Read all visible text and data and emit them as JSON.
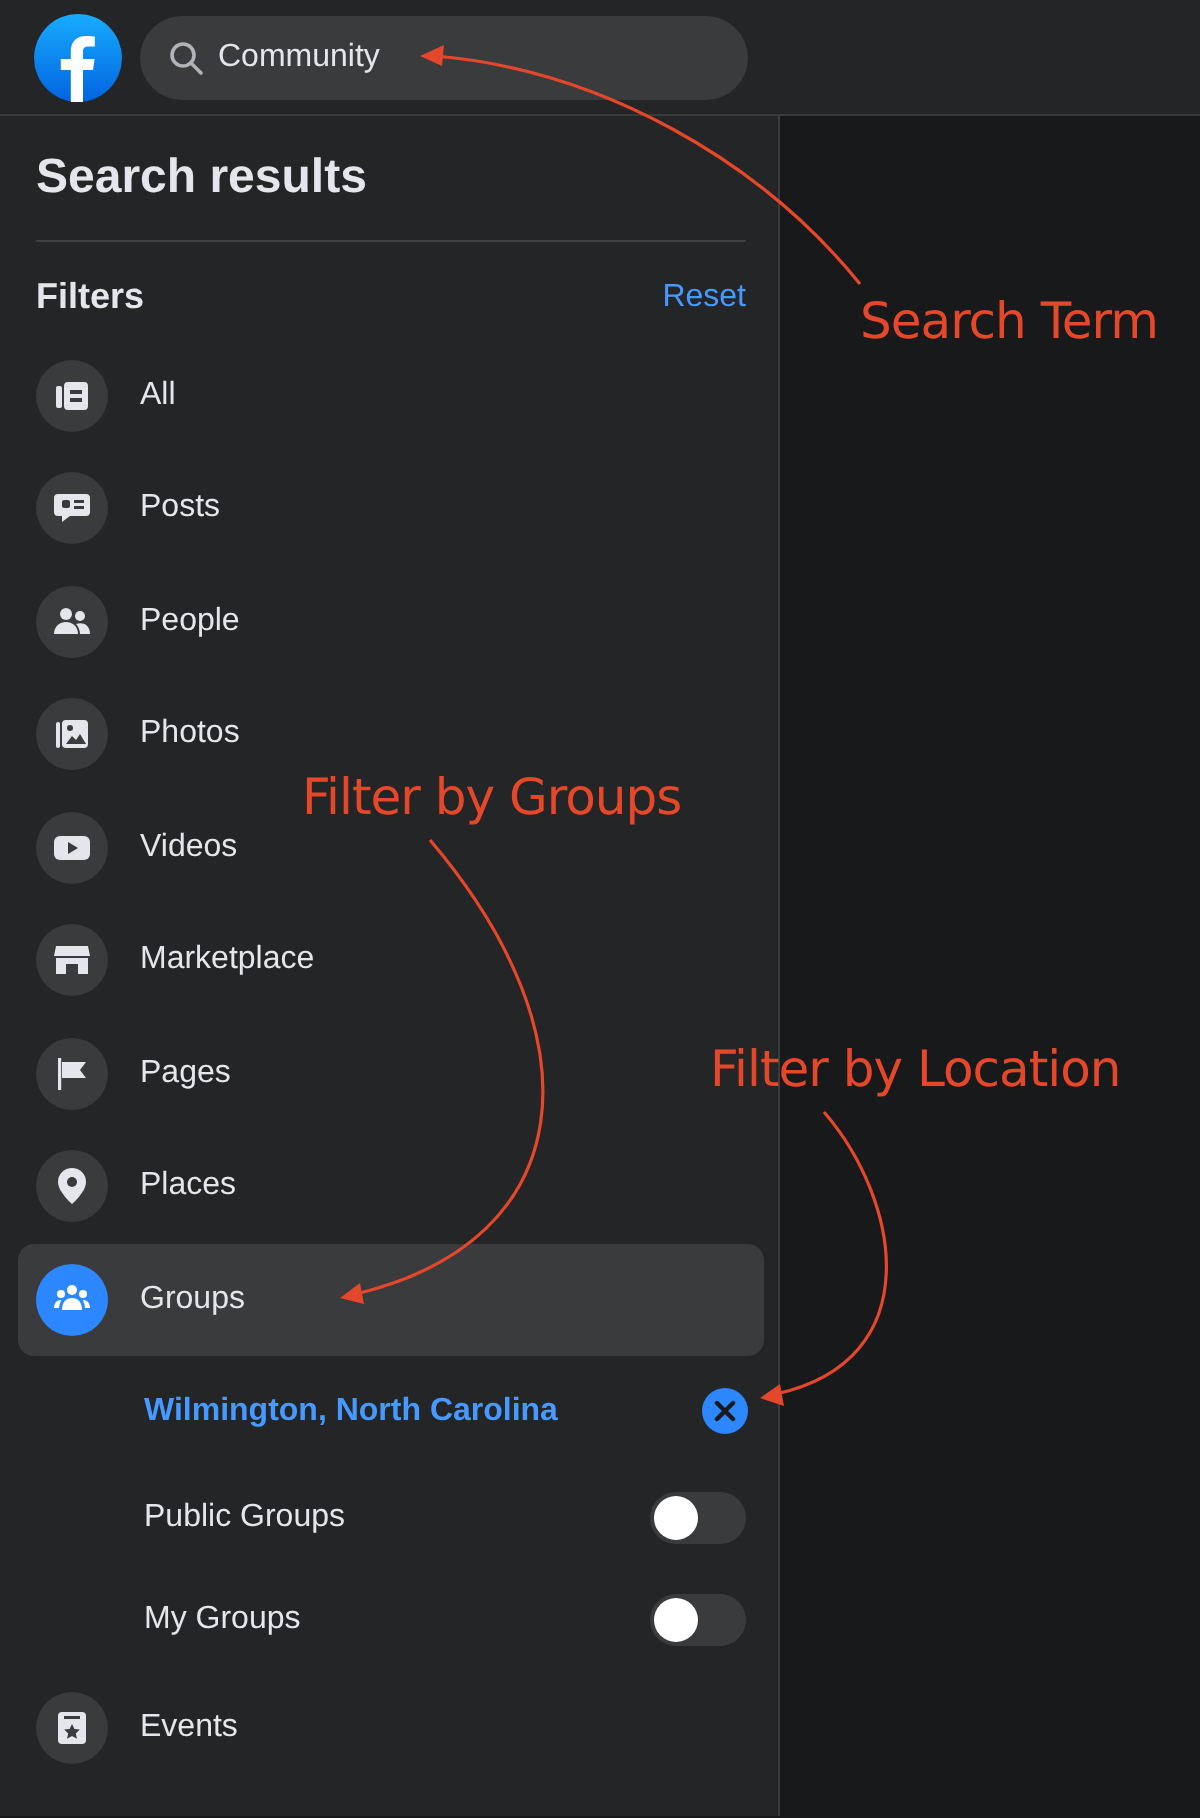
{
  "search": {
    "value": "Community"
  },
  "panel": {
    "title": "Search results",
    "filters_label": "Filters",
    "reset": "Reset",
    "filters": [
      {
        "kind": "all",
        "label": "All",
        "selected": false
      },
      {
        "kind": "posts",
        "label": "Posts",
        "selected": false
      },
      {
        "kind": "people",
        "label": "People",
        "selected": false
      },
      {
        "kind": "photos",
        "label": "Photos",
        "selected": false
      },
      {
        "kind": "videos",
        "label": "Videos",
        "selected": false
      },
      {
        "kind": "marketplace",
        "label": "Marketplace",
        "selected": false
      },
      {
        "kind": "pages",
        "label": "Pages",
        "selected": false
      },
      {
        "kind": "places",
        "label": "Places",
        "selected": false
      },
      {
        "kind": "groups",
        "label": "Groups",
        "selected": true,
        "location": "Wilmington, North Carolina",
        "toggles": [
          {
            "label": "Public Groups",
            "on": false
          },
          {
            "label": "My Groups",
            "on": false
          }
        ]
      },
      {
        "kind": "events",
        "label": "Events",
        "selected": false
      }
    ]
  },
  "annotations": [
    {
      "text": "Search Term"
    },
    {
      "text": "Filter by Groups"
    },
    {
      "text": "Filter by Location"
    }
  ]
}
